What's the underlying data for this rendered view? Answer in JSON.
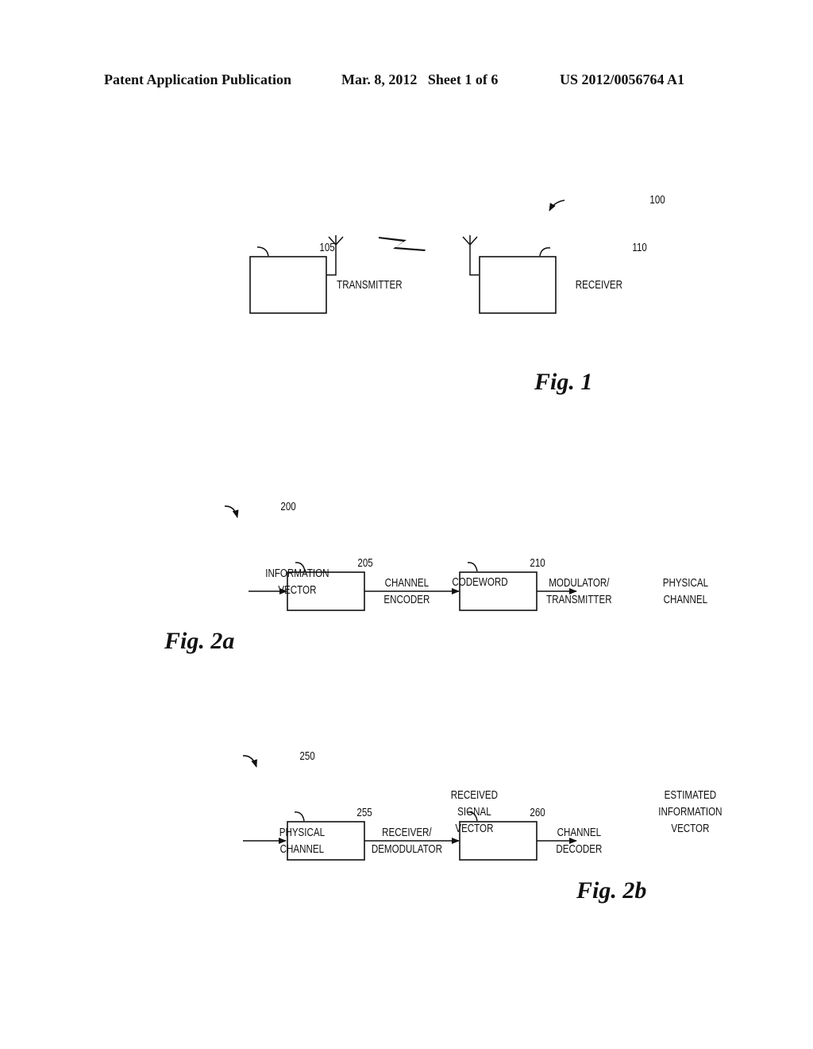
{
  "header": {
    "publication": "Patent Application Publication",
    "date_sheet": "Mar. 8, 2012   Sheet 1 of 6",
    "patent_number": "US 2012/0056764 A1"
  },
  "fig1": {
    "caption": "Fig. 1",
    "ref_system": "100",
    "transmitter": {
      "ref": "105",
      "label": "TRANSMITTER"
    },
    "receiver": {
      "ref": "110",
      "label": "RECEIVER"
    }
  },
  "fig2a": {
    "caption": "Fig. 2a",
    "ref_system": "200",
    "input_label": [
      "INFORMATION",
      "VECTOR"
    ],
    "block1": {
      "ref": "205",
      "label": [
        "CHANNEL",
        "ENCODER"
      ]
    },
    "mid_label": [
      "CODEWORD"
    ],
    "block2": {
      "ref": "210",
      "label": [
        "MODULATOR/",
        "TRANSMITTER"
      ]
    },
    "output_label": [
      "PHYSICAL",
      "CHANNEL"
    ]
  },
  "fig2b": {
    "caption": "Fig. 2b",
    "ref_system": "250",
    "input_label": [
      "PHYSICAL",
      "CHANNEL"
    ],
    "block1": {
      "ref": "255",
      "label": [
        "RECEIVER/",
        "DEMODULATOR"
      ]
    },
    "mid_label": [
      "RECEIVED",
      "SIGNAL",
      "VECTOR"
    ],
    "block2": {
      "ref": "260",
      "label": [
        "CHANNEL",
        "DECODER"
      ]
    },
    "output_label": [
      "ESTIMATED",
      "INFORMATION",
      "VECTOR"
    ]
  }
}
